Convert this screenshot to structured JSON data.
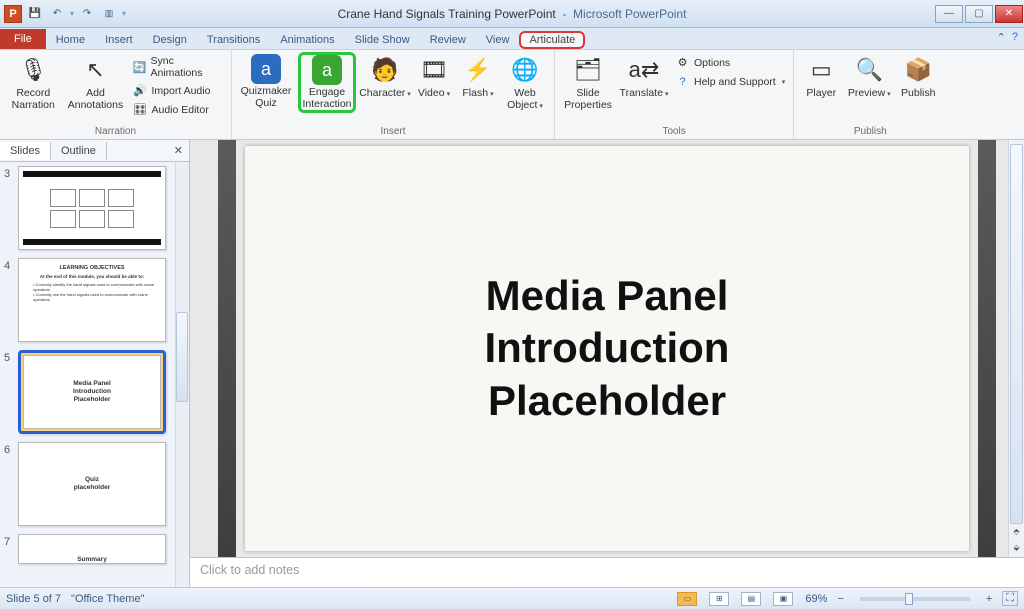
{
  "title": {
    "doc": "Crane Hand Signals Training PowerPoint",
    "app": "Microsoft PowerPoint"
  },
  "tabs": {
    "file": "File",
    "list": [
      "Home",
      "Insert",
      "Design",
      "Transitions",
      "Animations",
      "Slide Show",
      "Review",
      "View",
      "Articulate"
    ],
    "active": "Articulate"
  },
  "ribbon": {
    "narration": {
      "label": "Narration",
      "record": "Record Narration",
      "add_ann": "Add Annotations",
      "sync": "Sync Animations",
      "import": "Import Audio",
      "editor": "Audio Editor"
    },
    "insert": {
      "label": "Insert",
      "quiz": "Quizmaker Quiz",
      "engage": "Engage Interaction",
      "char": "Character",
      "video": "Video",
      "flash": "Flash",
      "web": "Web Object"
    },
    "tools": {
      "label": "Tools",
      "props": "Slide Properties",
      "translate": "Translate",
      "options": "Options",
      "help": "Help and Support"
    },
    "publish": {
      "label": "Publish",
      "player": "Player",
      "preview": "Preview",
      "publish": "Publish"
    }
  },
  "side": {
    "tabs": {
      "slides": "Slides",
      "outline": "Outline"
    }
  },
  "thumbs": [
    {
      "n": "3",
      "caption": ""
    },
    {
      "n": "4",
      "title": "LEARNING OBJECTIVES",
      "line1": "At the end of this module, you should be able to:",
      "b1": "Correctly identify the hand signals used to communicate with crane operators",
      "b2": "Correctly use the hand signals used to communicate with crane operators"
    },
    {
      "n": "5",
      "l1": "Media Panel",
      "l2": "Introduction",
      "l3": "Placeholder"
    },
    {
      "n": "6",
      "l1": "Quiz",
      "l2": "placeholder"
    },
    {
      "n": "7",
      "l1": "Summary"
    }
  ],
  "slide": {
    "l1": "Media Panel",
    "l2": "Introduction",
    "l3": "Placeholder"
  },
  "notes_placeholder": "Click to add notes",
  "status": {
    "slide": "Slide 5 of 7",
    "theme": "\"Office Theme\"",
    "zoom": "69%"
  }
}
